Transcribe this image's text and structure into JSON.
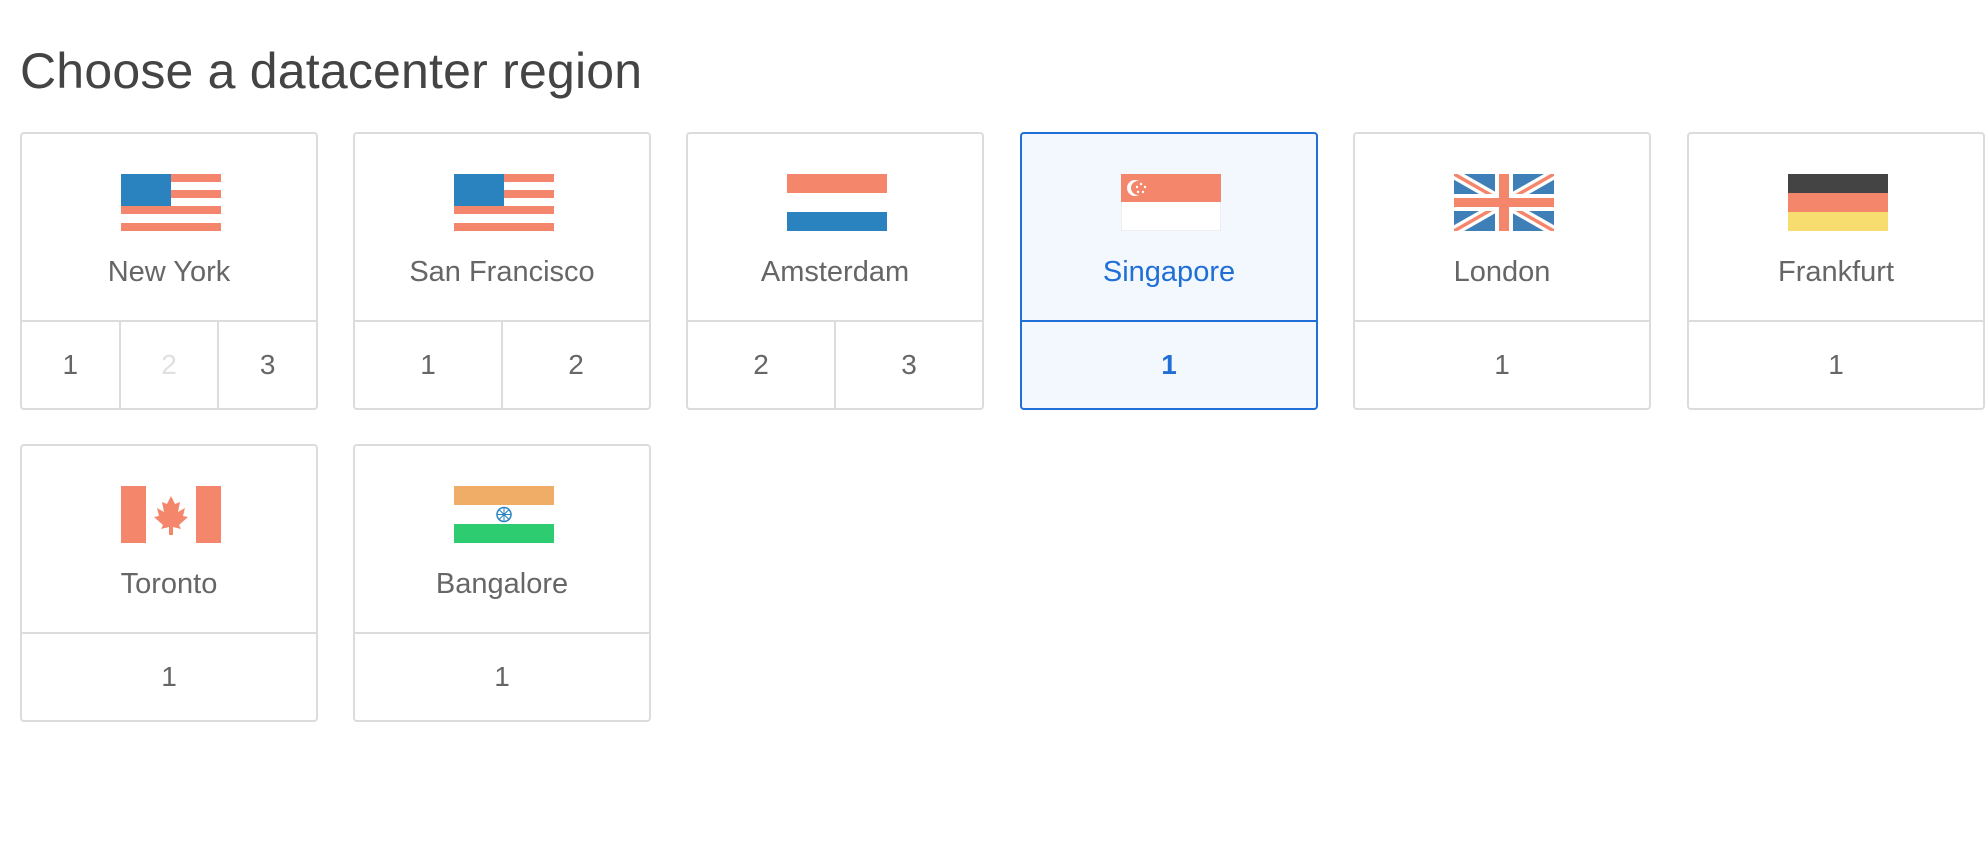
{
  "page": {
    "title": "Choose a datacenter region"
  },
  "regions": [
    {
      "city": "New York",
      "flag": "us-flag-icon",
      "datacenters": [
        "1",
        "2",
        "3"
      ],
      "disabled": [
        "2"
      ],
      "selected": false
    },
    {
      "city": "San Francisco",
      "flag": "us-flag-icon",
      "datacenters": [
        "1",
        "2"
      ],
      "selected": false
    },
    {
      "city": "Amsterdam",
      "flag": "netherlands-flag-icon",
      "datacenters": [
        "2",
        "3"
      ],
      "selected": false
    },
    {
      "city": "Singapore",
      "flag": "singapore-flag-icon",
      "datacenters": [
        "1"
      ],
      "selected": true
    },
    {
      "city": "London",
      "flag": "uk-flag-icon",
      "datacenters": [
        "1"
      ],
      "selected": false
    },
    {
      "city": "Frankfurt",
      "flag": "germany-flag-icon",
      "datacenters": [
        "1"
      ],
      "selected": false
    },
    {
      "city": "Toronto",
      "flag": "canada-flag-icon",
      "datacenters": [
        "1"
      ],
      "selected": false
    },
    {
      "city": "Bangalore",
      "flag": "india-flag-icon",
      "datacenters": [
        "1"
      ],
      "selected": false
    }
  ],
  "colors": {
    "accent": "#1f6fd6",
    "selected_bg": "#f3f7fe",
    "border": "#dcdcdc",
    "flag_blue": "#2a83bf",
    "flag_salmon": "#f4876b",
    "flag_dark": "#444444",
    "flag_yellow": "#f7dc6f",
    "flag_saffron": "#f0ad67",
    "flag_green": "#2ecc71"
  }
}
